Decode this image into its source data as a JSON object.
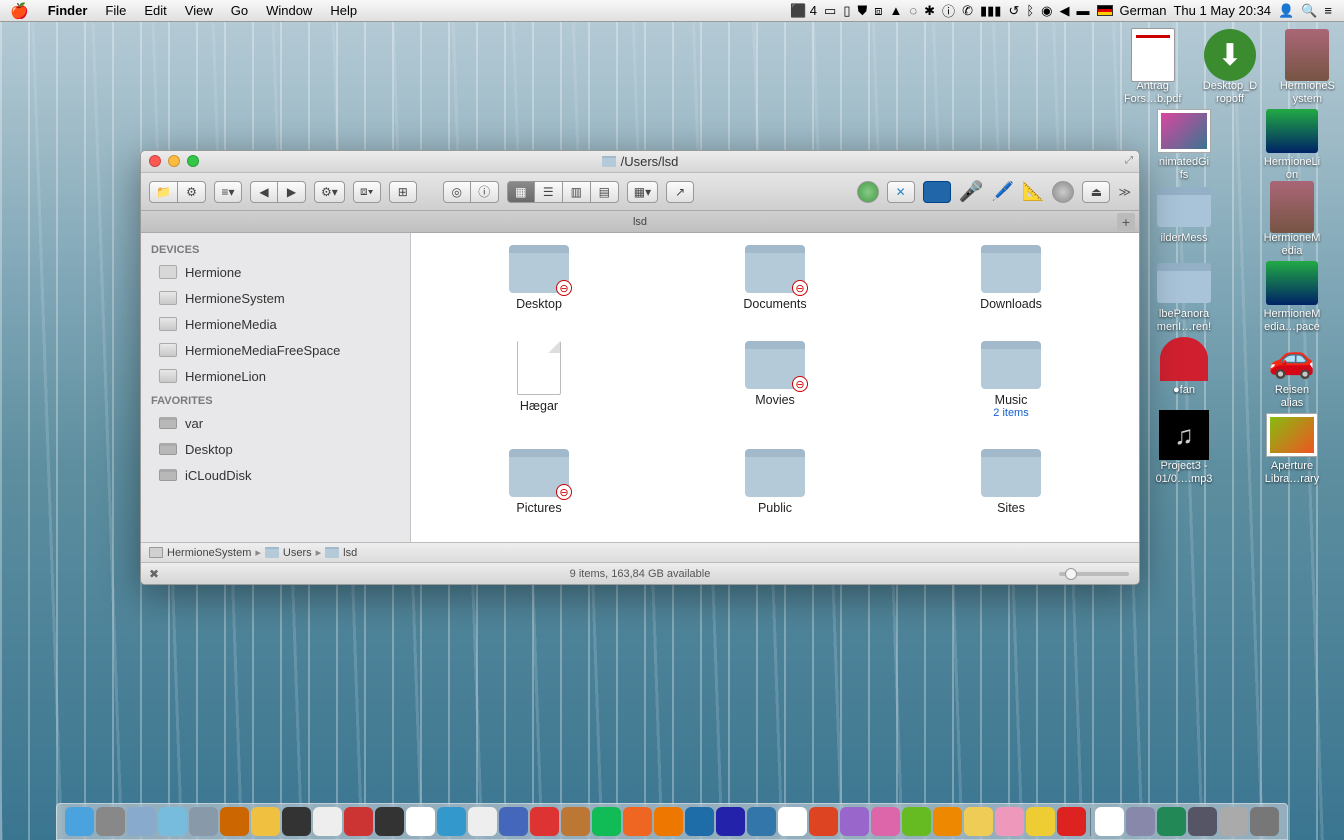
{
  "menubar": {
    "app": "Finder",
    "items": [
      "File",
      "Edit",
      "View",
      "Go",
      "Window",
      "Help"
    ],
    "right_badge": "4",
    "input_lang": "German",
    "datetime": "Thu 1 May  20:34"
  },
  "desktop_icons": [
    [
      {
        "type": "doc",
        "label": "Antrag\nFors…b.pdf"
      },
      {
        "type": "download",
        "label": "Desktop_D\nropoff"
      },
      {
        "type": "face",
        "label": "HermioneS\nystem"
      }
    ],
    [
      {
        "type": "photo",
        "label": "nimatedGi\nfs"
      },
      {
        "type": "wallp",
        "label": "HermioneLi\non"
      }
    ],
    [
      {
        "type": "folder",
        "label": "ilderMess"
      },
      {
        "type": "face",
        "label": "HermioneM\nedia"
      }
    ],
    [
      {
        "type": "folder",
        "label": "lbePanora\nmenI…ren!"
      },
      {
        "type": "wallp",
        "label": "HermioneM\nedia…pace"
      }
    ],
    [
      {
        "type": "fan",
        "label": "●fan"
      },
      {
        "type": "car",
        "label": "Reisen\nalias"
      }
    ],
    [
      {
        "type": "music",
        "label": "Project3 -\n01/0….mp3"
      },
      {
        "type": "aperture",
        "label": "Aperture\nLibra…rary"
      }
    ]
  ],
  "finder": {
    "title": "/Users/lsd",
    "tab": "lsd",
    "sidebar": {
      "devices_heading": "DEVICES",
      "devices": [
        {
          "icon": "hd",
          "name": "Hermione"
        },
        {
          "icon": "vol",
          "name": "HermioneSystem"
        },
        {
          "icon": "vol",
          "name": "HermioneMedia"
        },
        {
          "icon": "vol",
          "name": "HermioneMediaFreeSpace"
        },
        {
          "icon": "vol",
          "name": "HermioneLion"
        }
      ],
      "favorites_heading": "FAVORITES",
      "favorites": [
        {
          "icon": "fold",
          "name": "var"
        },
        {
          "icon": "fold",
          "name": "Desktop"
        },
        {
          "icon": "fold",
          "name": "iCLoudDisk"
        }
      ]
    },
    "items": [
      {
        "type": "folder",
        "restricted": true,
        "name": "Desktop",
        "sub": ""
      },
      {
        "type": "folder",
        "restricted": true,
        "name": "Documents",
        "sub": ""
      },
      {
        "type": "folder",
        "restricted": false,
        "name": "Downloads",
        "sub": ""
      },
      {
        "type": "file",
        "restricted": false,
        "name": "Hægar",
        "sub": ""
      },
      {
        "type": "folder",
        "restricted": true,
        "name": "Movies",
        "sub": ""
      },
      {
        "type": "folder",
        "restricted": false,
        "name": "Music",
        "sub": "2 items"
      },
      {
        "type": "folder",
        "restricted": true,
        "name": "Pictures",
        "sub": ""
      },
      {
        "type": "folder",
        "restricted": false,
        "name": "Public",
        "sub": ""
      },
      {
        "type": "folder",
        "restricted": false,
        "name": "Sites",
        "sub": ""
      }
    ],
    "path": [
      {
        "icon": "hd",
        "label": "HermioneSystem"
      },
      {
        "icon": "fold",
        "label": "Users"
      },
      {
        "icon": "fold",
        "label": "lsd"
      }
    ],
    "status": "9 items, 163,84 GB available"
  },
  "dock_colors": [
    "#4aa3df",
    "#888",
    "#8ac",
    "#7bd",
    "#89a",
    "#c60",
    "#f0c040",
    "#333",
    "#eee",
    "#c33",
    "#333",
    "#fff",
    "#39c",
    "#eee",
    "#46b",
    "#d33",
    "#b73",
    "#1b5",
    "#e62",
    "#e70",
    "#1f6da8",
    "#22a",
    "#37a",
    "#fff",
    "#d42",
    "#96c",
    "#d6a",
    "#6b2",
    "#e80",
    "#ec5",
    "#e9b",
    "#ec3",
    "#d22",
    "#fff",
    "#88a",
    "#285",
    "#556",
    "#aaa",
    "#777"
  ]
}
